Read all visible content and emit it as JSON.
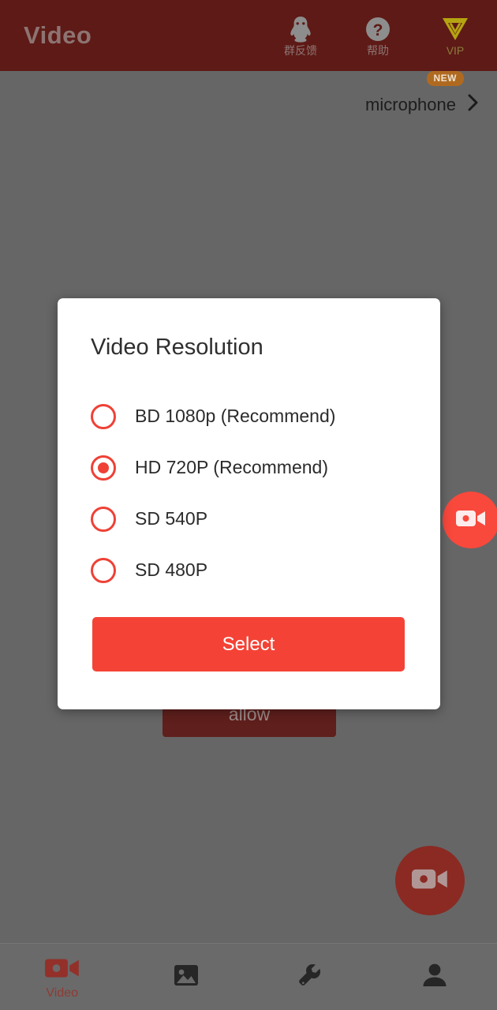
{
  "header": {
    "title": "Video",
    "actions": [
      {
        "label": "群反馈",
        "icon": "qq-penguin-icon"
      },
      {
        "label": "帮助",
        "icon": "help-question-icon"
      },
      {
        "label": "VIP",
        "icon": "vip-diamond-icon"
      }
    ]
  },
  "microphone_row": {
    "label": "microphone",
    "badge": "NEW",
    "chevron": "›"
  },
  "background": {
    "allow_button": "allow",
    "fab_icon": "video-camera-icon"
  },
  "dialog": {
    "title": "Video Resolution",
    "options": [
      {
        "label": "BD 1080p (Recommend)",
        "selected": false
      },
      {
        "label": "HD 720P (Recommend)",
        "selected": true
      },
      {
        "label": "SD 540P",
        "selected": false
      },
      {
        "label": "SD 480P",
        "selected": false
      }
    ],
    "confirm_label": "Select"
  },
  "bottom_nav": {
    "items": [
      {
        "label": "Video",
        "icon": "video-camera-icon",
        "active": true
      },
      {
        "label": "",
        "icon": "image-gallery-icon",
        "active": false
      },
      {
        "label": "",
        "icon": "wrench-icon",
        "active": false
      },
      {
        "label": "",
        "icon": "person-icon",
        "active": false
      }
    ]
  },
  "colors": {
    "header_bg": "#5e1a16",
    "scrim": "#666666",
    "accent_red": "#f44336",
    "radio_red": "#ef4136",
    "badge_orange": "#b06a20",
    "vip_gold": "#b5a411"
  }
}
